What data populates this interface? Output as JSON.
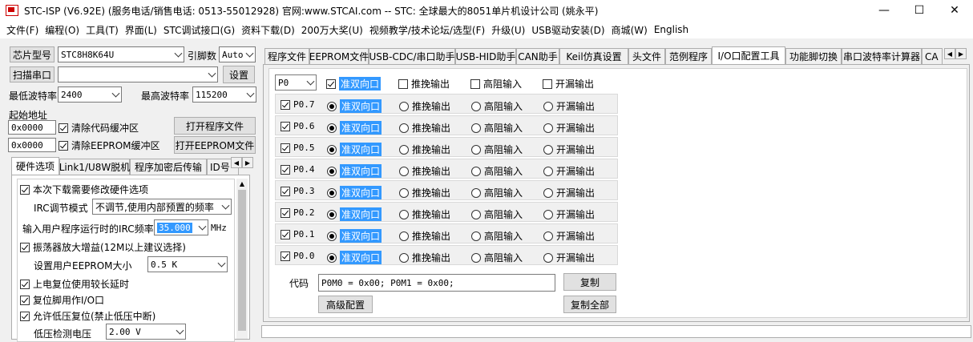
{
  "window": {
    "title": "STC-ISP (V6.92E) (服务电话/销售电话: 0513-55012928) 官网:www.STCAI.com  -- STC: 全球最大的8051单片机设计公司 (姚永平)",
    "minimize": "—",
    "maximize": "☐",
    "close": "✕"
  },
  "menu": [
    "文件(F)",
    "编程(O)",
    "工具(T)",
    "界面(L)",
    "STC调试接口(G)",
    "资料下载(D)",
    "200万大奖(U)",
    "视频教学/技术论坛/选型(F)",
    "升级(U)",
    "USB驱动安装(D)",
    "商城(W)",
    "English"
  ],
  "left": {
    "chip_label": "芯片型号",
    "chip_value": "STC8H8K64U",
    "pin_label": "引脚数",
    "pin_value": "Auto",
    "scan_label": "扫描串口",
    "port_value": "",
    "settings_label": "设置",
    "min_baud_label": "最低波特率",
    "min_baud": "2400",
    "max_baud_label": "最高波特率",
    "max_baud": "115200",
    "start_addr_label": "起始地址",
    "addr1": "0x0000",
    "clear_code_label": "清除代码缓冲区",
    "open_prog_label": "打开程序文件",
    "addr2": "0x0000",
    "clear_eeprom_label": "清除EEPROM缓冲区",
    "open_eeprom_label": "打开EEPROM文件",
    "tabs": [
      "硬件选项",
      "Link1/U8W脱机",
      "程序加密后传输",
      "ID号"
    ],
    "hw": {
      "modify_label": "本次下载需要修改硬件选项",
      "irc_mode_label": "IRC调节模式",
      "irc_mode_value": "不调节,使用内部预置的频率",
      "irc_freq_label": "输入用户程序运行时的IRC频率",
      "irc_freq_value": "35.000",
      "irc_unit": "MHz",
      "osc_label": "振荡器放大增益(12M以上建议选择)",
      "eeprom_size_label": "设置用户EEPROM大小",
      "eeprom_size_value": "0.5 K",
      "por_label": "上电复位使用较长延时",
      "reset_io_label": "复位脚用作I/O口",
      "lvr_label": "允许低压复位(禁止低压中断)",
      "lv_label": "低压检测电压",
      "lv_value": "2.00 V"
    }
  },
  "right": {
    "tabs": [
      "程序文件",
      "EEPROM文件",
      "USB-CDC/串口助手",
      "USB-HID助手",
      "CAN助手",
      "Keil仿真设置",
      "头文件",
      "范例程序",
      "I/O口配置工具",
      "功能脚切换",
      "串口波特率计算器",
      "CA"
    ],
    "port_select": "P0",
    "header_opts": [
      "准双向口",
      "推挽输出",
      "高阻输入",
      "开漏输出"
    ],
    "pins": [
      "P0.7",
      "P0.6",
      "P0.5",
      "P0.4",
      "P0.3",
      "P0.2",
      "P0.1",
      "P0.0"
    ],
    "row_opts": [
      "准双向口",
      "推挽输出",
      "高阻输入",
      "开漏输出"
    ],
    "code_label": "代码",
    "code_value": "P0M0 = 0x00; P0M1 = 0x00;",
    "copy_label": "复制",
    "advanced_label": "高级配置",
    "copy_all_label": "复制全部"
  },
  "colors": {
    "highlight": "#3399ff"
  }
}
